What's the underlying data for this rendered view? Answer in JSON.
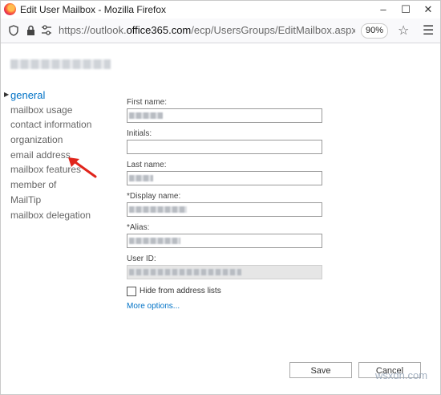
{
  "window": {
    "title": "Edit User Mailbox - Mozilla Firefox",
    "controls": {
      "minimize": "–",
      "maximize": "☐",
      "close": "✕"
    }
  },
  "addressbar": {
    "url_prefix": "https://outlook.",
    "url_domain": "office365.com",
    "url_suffix": "/ecp/UsersGroups/EditMailbox.aspx?Activ",
    "zoom": "90%"
  },
  "nav": {
    "items": [
      {
        "label": "general",
        "active": true
      },
      {
        "label": "mailbox usage"
      },
      {
        "label": "contact information"
      },
      {
        "label": "organization"
      },
      {
        "label": "email address"
      },
      {
        "label": "mailbox features"
      },
      {
        "label": "member of"
      },
      {
        "label": "MailTip"
      },
      {
        "label": "mailbox delegation"
      }
    ]
  },
  "form": {
    "first_name": {
      "label": "First name:"
    },
    "initials": {
      "label": "Initials:"
    },
    "last_name": {
      "label": "Last name:"
    },
    "display_name": {
      "label": "*Display name:"
    },
    "alias": {
      "label": "*Alias:"
    },
    "user_id": {
      "label": "User ID:"
    },
    "hide_from_lists": {
      "label": "Hide from address lists",
      "checked": false
    },
    "more_options": "More options..."
  },
  "buttons": {
    "save": "Save",
    "cancel": "Cancel"
  },
  "annotation": {
    "arrow_color": "#e0241b"
  },
  "watermark": "wsxdn.com"
}
